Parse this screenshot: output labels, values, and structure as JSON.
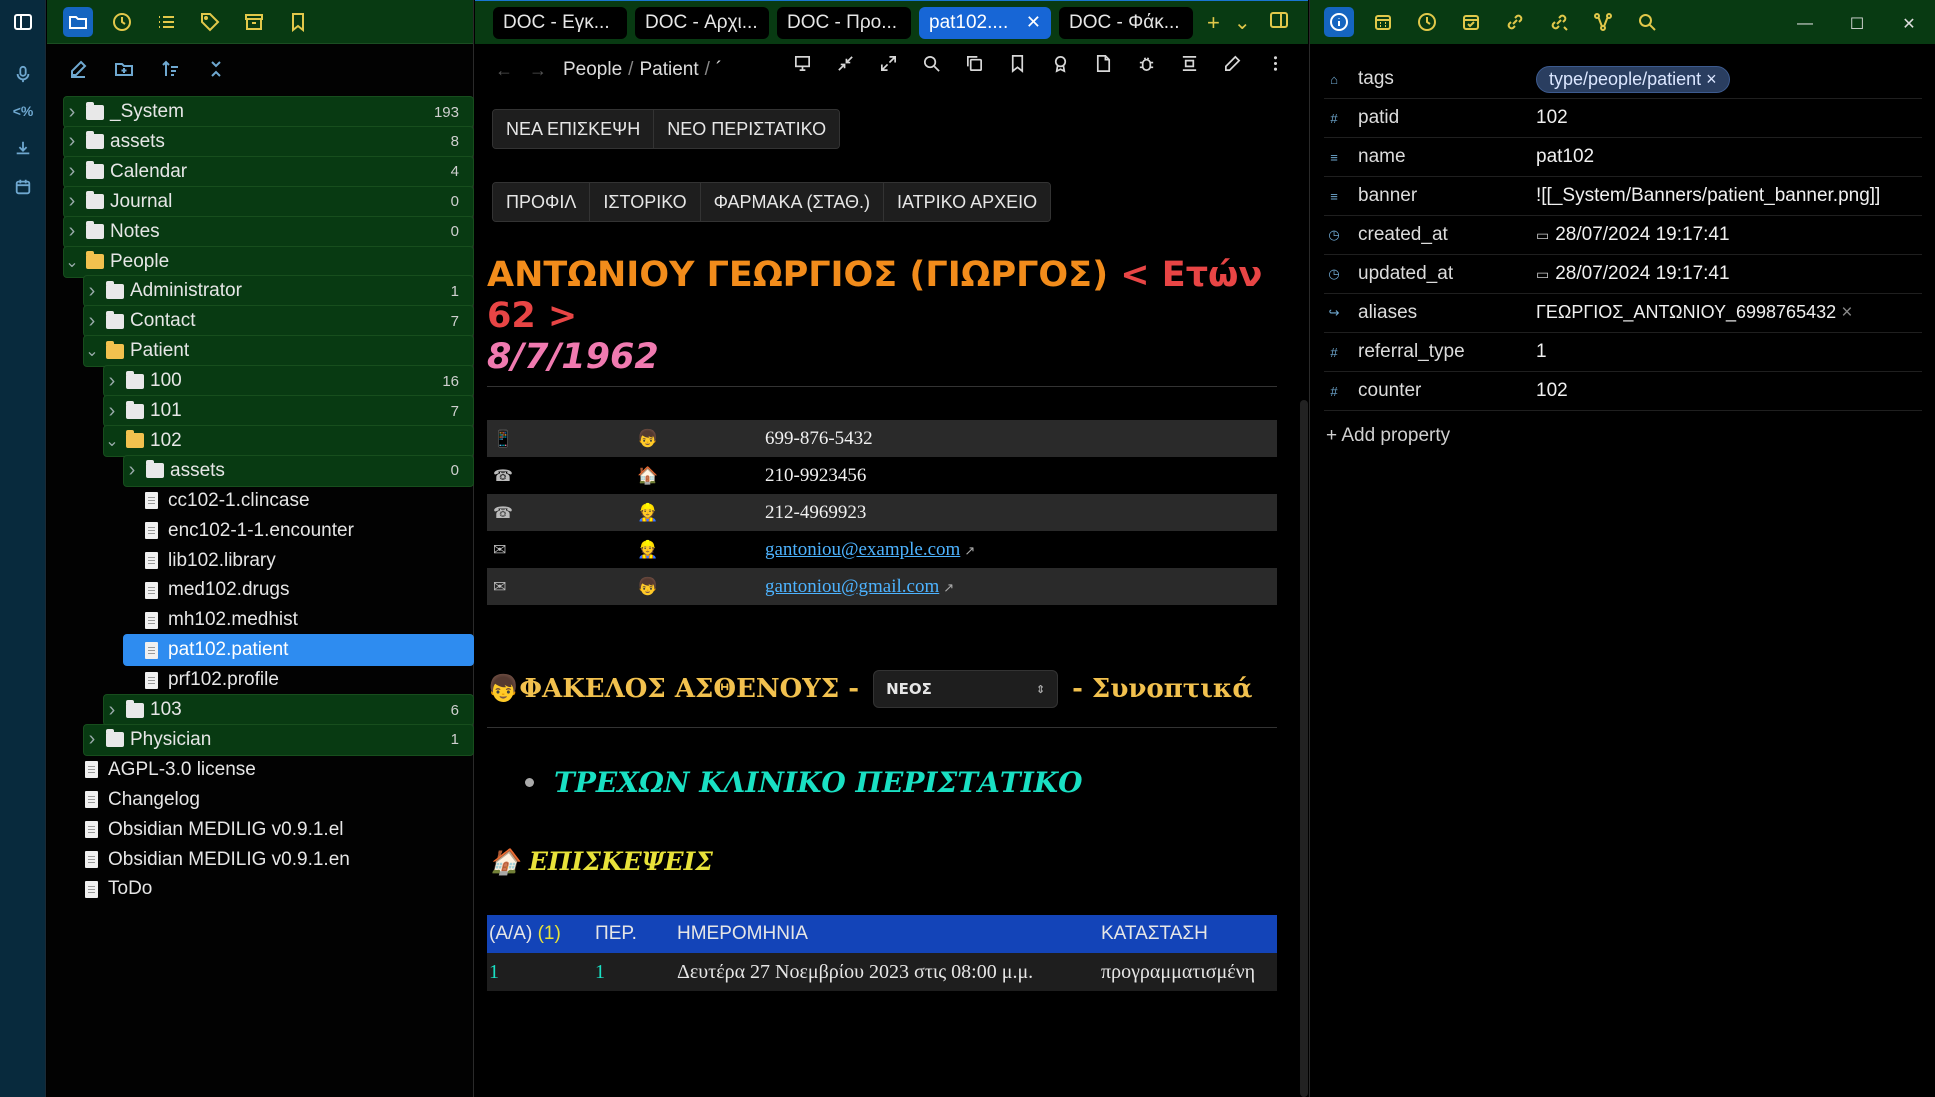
{
  "sidebar": {
    "tree": [
      {
        "label": "_System",
        "count": "193",
        "type": "folder",
        "depth": 0,
        "expanded": false,
        "boxed": true
      },
      {
        "label": "assets",
        "count": "8",
        "type": "folder",
        "depth": 0,
        "expanded": false,
        "boxed": true
      },
      {
        "label": "Calendar",
        "count": "4",
        "type": "folder",
        "depth": 0,
        "expanded": false,
        "boxed": true
      },
      {
        "label": "Journal",
        "count": "0",
        "type": "folder",
        "depth": 0,
        "expanded": false,
        "boxed": true
      },
      {
        "label": "Notes",
        "count": "0",
        "type": "folder",
        "depth": 0,
        "expanded": false,
        "boxed": true
      },
      {
        "label": "People",
        "count": "",
        "type": "folder",
        "depth": 0,
        "expanded": true,
        "boxed": true
      },
      {
        "label": "Administrator",
        "count": "1",
        "type": "folder",
        "depth": 1,
        "expanded": false,
        "boxed": true
      },
      {
        "label": "Contact",
        "count": "7",
        "type": "folder",
        "depth": 1,
        "expanded": false,
        "boxed": true
      },
      {
        "label": "Patient",
        "count": "",
        "type": "folder",
        "depth": 1,
        "expanded": true,
        "boxed": true
      },
      {
        "label": "100",
        "count": "16",
        "type": "folder",
        "depth": 2,
        "expanded": false,
        "boxed": true
      },
      {
        "label": "101",
        "count": "7",
        "type": "folder",
        "depth": 2,
        "expanded": false,
        "boxed": true
      },
      {
        "label": "102",
        "count": "",
        "type": "folder",
        "depth": 2,
        "expanded": true,
        "boxed": true
      },
      {
        "label": "assets",
        "count": "0",
        "type": "folder",
        "depth": 3,
        "expanded": false,
        "boxed": true
      },
      {
        "label": "cc102-1.clincase",
        "count": "",
        "type": "file",
        "depth": 3
      },
      {
        "label": "enc102-1-1.encounter",
        "count": "",
        "type": "file",
        "depth": 3
      },
      {
        "label": "lib102.library",
        "count": "",
        "type": "file",
        "depth": 3
      },
      {
        "label": "med102.drugs",
        "count": "",
        "type": "file",
        "depth": 3
      },
      {
        "label": "mh102.medhist",
        "count": "",
        "type": "file",
        "depth": 3
      },
      {
        "label": "pat102.patient",
        "count": "",
        "type": "file",
        "depth": 3,
        "selected": true
      },
      {
        "label": "prf102.profile",
        "count": "",
        "type": "file",
        "depth": 3
      },
      {
        "label": "103",
        "count": "6",
        "type": "folder",
        "depth": 2,
        "expanded": false,
        "boxed": true
      },
      {
        "label": "Physician",
        "count": "1",
        "type": "folder",
        "depth": 1,
        "expanded": false,
        "boxed": true
      },
      {
        "label": "AGPL-3.0 license",
        "count": "",
        "type": "file",
        "depth": 0
      },
      {
        "label": "Changelog",
        "count": "",
        "type": "file",
        "depth": 0
      },
      {
        "label": "Obsidian MEDILIG v0.9.1.el",
        "count": "",
        "type": "file",
        "depth": 0
      },
      {
        "label": "Obsidian MEDILIG v0.9.1.en",
        "count": "",
        "type": "file",
        "depth": 0
      },
      {
        "label": "ToDo",
        "count": "",
        "type": "file",
        "depth": 0
      }
    ]
  },
  "tabs": [
    {
      "label": "DOC - Εγκ..."
    },
    {
      "label": "DOC - Αρχι..."
    },
    {
      "label": "DOC - Προ..."
    },
    {
      "label": "pat102....",
      "active": true
    },
    {
      "label": "DOC - Φάκ..."
    }
  ],
  "breadcrumb": {
    "a": "People",
    "b": "Patient",
    "c": "´"
  },
  "buttons_top": [
    "ΝΕΑ ΕΠΙΣΚΕΨΗ",
    "ΝΕΟ ΠΕΡΙΣΤΑΤΙΚΟ"
  ],
  "buttons_nav": [
    "ΠΡΟΦΙΛ",
    "ΙΣΤΟΡΙΚΟ",
    "ΦΑΡΜΑΚΑ (ΣΤΑΘ.)",
    "ΙΑΤΡΙΚΟ ΑΡΧΕΙΟ"
  ],
  "patient": {
    "name": "ΑΝΤΩΝΙΟΥ ΓΕΩΡΓΙΟΣ (ΓΙΩΡΓΟΣ)",
    "age": "< Ετών 62 >",
    "dob": "8/7/1962"
  },
  "contacts": [
    {
      "kind": "📱",
      "who": "👦",
      "value": "699-876-5432",
      "link": false
    },
    {
      "kind": "☎",
      "who": "🏠",
      "value": "210-9923456",
      "link": false
    },
    {
      "kind": "☎",
      "who": "👷",
      "value": "212-4969923",
      "link": false
    },
    {
      "kind": "✉",
      "who": "👷",
      "value": "gantoniou@example.com",
      "link": true
    },
    {
      "kind": "✉",
      "who": "👦",
      "value": "gantoniou@gmail.com",
      "link": true
    }
  ],
  "folder": {
    "icon": "👦",
    "title": "ΦΑΚΕΛΟΣ ΑΣΘΕΝΟΥΣ -",
    "select_value": "ΝΕΟΣ",
    "suffix": "- Συνοπτικά"
  },
  "current_case": "ΤΡΕΧΩΝ ΚΛΙΝΙΚΟ ΠΕΡΙΣΤΑΤΙΚΟ",
  "visits": {
    "icon": "🏠",
    "title": "ΕΠΙΣΚΕΨΕΙΣ",
    "headers": {
      "aa": "(Α/Α)",
      "aa_count": "(1)",
      "per": "ΠΕΡ.",
      "date": "ΗΜΕΡΟΜΗΝΙΑ",
      "status": "ΚΑΤΑΣΤΑΣΗ"
    },
    "rows": [
      {
        "aa": "1",
        "per": "1",
        "date": "Δευτέρα 27 Νοεμβρίου 2023 στις 08:00 μ.μ.",
        "status": "προγραμματισμένη"
      }
    ]
  },
  "properties": [
    {
      "key": "tags",
      "icon": "tag-icon",
      "glyph": "⌂",
      "value": "type/people/patient",
      "kind": "tag"
    },
    {
      "key": "patid",
      "icon": "number-icon",
      "glyph": "#",
      "value": "102"
    },
    {
      "key": "name",
      "icon": "text-icon",
      "glyph": "≡",
      "value": "pat102"
    },
    {
      "key": "banner",
      "icon": "text-icon",
      "glyph": "≡",
      "value": "![[_System/Banners/patient_banner.png]]"
    },
    {
      "key": "created_at",
      "icon": "clock-icon",
      "glyph": "◷",
      "value": "28/07/2024 19:17:41",
      "kind": "date"
    },
    {
      "key": "updated_at",
      "icon": "clock-icon",
      "glyph": "◷",
      "value": "28/07/2024 19:17:41",
      "kind": "date"
    },
    {
      "key": "aliases",
      "icon": "alias-icon",
      "glyph": "↪",
      "value": "ΓΕΩΡΓΙΟΣ_ΑΝΤΩΝΙΟΥ_6998765432",
      "kind": "alias"
    },
    {
      "key": "referral_type",
      "icon": "number-icon",
      "glyph": "#",
      "value": "1"
    },
    {
      "key": "counter",
      "icon": "number-icon",
      "glyph": "#",
      "value": "102"
    }
  ],
  "add_property": "+ Add property"
}
